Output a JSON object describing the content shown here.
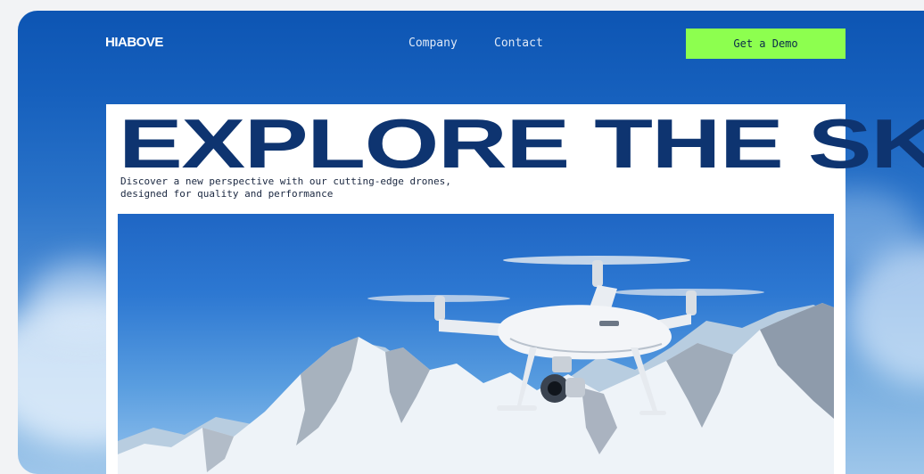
{
  "brand": {
    "logo": "HIABOVE"
  },
  "nav": {
    "links": [
      {
        "label": "Company"
      },
      {
        "label": "Contact"
      }
    ],
    "cta_label": "Get a Demo"
  },
  "hero": {
    "title": "EXPLORE THE SKY",
    "subtitle_line1": "Discover a new perspective with our cutting-edge drones,",
    "subtitle_line2": "designed for quality and performance",
    "image": "drone-over-snowy-mountains"
  },
  "colors": {
    "primary_blue": "#0d55b3",
    "title_navy": "#0e3470",
    "cta_green": "#8dff4f",
    "card_white": "#ffffff"
  },
  "icons": [
    "drone-illustration"
  ]
}
